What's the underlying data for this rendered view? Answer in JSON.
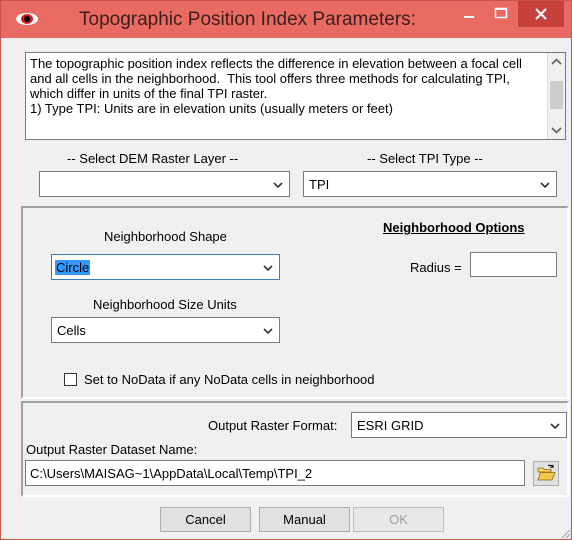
{
  "window": {
    "title": "Topographic Position Index Parameters:",
    "minimize_label": "‒",
    "maximize_label": "□",
    "close_label": "✕"
  },
  "description": {
    "text": "The topographic position index reflects the difference in elevation between a focal cell and all cells in the neighborhood.  This tool offers three methods for calculating TPI, which differ in units of the final TPI raster.\n1) Type TPI: Units are in elevation units (usually meters or feet)"
  },
  "inputs": {
    "dem_label": "-- Select DEM Raster Layer --",
    "dem_value": "",
    "tpi_type_label": "-- Select TPI Type --",
    "tpi_type_value": "TPI"
  },
  "neighborhood": {
    "options_heading": "Neighborhood Options",
    "shape_label": "Neighborhood Shape",
    "shape_value": "Circle",
    "radius_label": "Radius =",
    "radius_value": "",
    "size_units_label": "Neighborhood Size Units",
    "size_units_value": "Cells",
    "nodata_label": "Set to NoData if any NoData cells in neighborhood",
    "nodata_checked": false
  },
  "output": {
    "format_label": "Output Raster Format:",
    "format_value": "ESRI GRID",
    "dataset_label": "Output Raster Dataset Name:",
    "dataset_value": "C:\\Users\\MAISAG~1\\AppData\\Local\\Temp\\TPI_2"
  },
  "buttons": {
    "cancel": "Cancel",
    "manual": "Manual",
    "ok": "OK"
  },
  "icons": {
    "app": "eye-icon",
    "dropdown": "chevron-down-icon",
    "browse": "folder-open-icon"
  },
  "colors": {
    "titlebar": "#e96a62",
    "close_button": "#c7413a",
    "selection": "#3399ff",
    "window_bg": "#f0f0f0"
  }
}
